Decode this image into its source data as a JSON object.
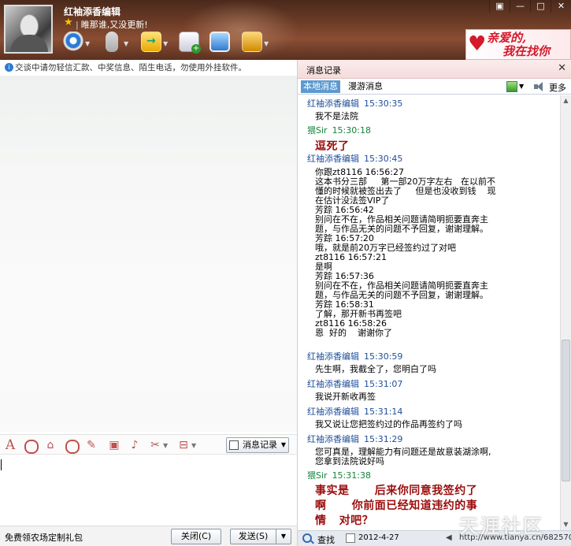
{
  "header": {
    "nickname": "红袖添香编辑",
    "signature": "睢那谁,又没更新!",
    "ad": {
      "line1": "亲爱的,",
      "line2": "我在找你"
    }
  },
  "left": {
    "notice": "交谈中请勿轻信汇款、中奖信息、陌生电话，勿使用外挂软件。",
    "history_button": "消息记录",
    "promo": "免费领农场定制礼包",
    "close_button": "关闭(C)",
    "send_button": "发送(S)"
  },
  "right": {
    "title": "消息记录",
    "tab_local": "本地消息",
    "tab_roam": "漫游消息",
    "more": "更多",
    "messages": [
      {
        "sender": "红袖添香编辑",
        "time": "15:30:35",
        "text": "我不是法院"
      },
      {
        "sender": "猥Sir",
        "time": "15:30:18",
        "text": "逗死了"
      },
      {
        "sender": "红袖添香编辑",
        "time": "15:30:45",
        "text": "你跟zt8116 16:56:27\n这本书分三部     第一部20万字左右   在以前不\n懂的时候就被签出去了     但是也没收到钱    现\n在估计没法签VIP了\n芳踪 16:56:42\n别问在不在，作品相关问题请简明扼要直奔主\n题，与作品无关的问题不予回复，谢谢理解。\n芳踪 16:57:20\n哦，就是前20万字已经签约过了对吧\nzt8116 16:57:21\n是啊\n芳踪 16:57:36\n别问在不在，作品相关问题请简明扼要直奔主\n题，与作品无关的问题不予回复，谢谢理解。\n芳踪 16:58:31\n了解，那开新书再签吧\nzt8116 16:58:26\n恩  好的    谢谢你了"
      },
      {
        "sender": "红袖添香编辑",
        "time": "15:30:59",
        "text": "先生啊，我截全了，您明白了吗"
      },
      {
        "sender": "红袖添香编辑",
        "time": "15:31:07",
        "text": "我说开新收再签"
      },
      {
        "sender": "红袖添香编辑",
        "time": "15:31:14",
        "text": "我又说让您把签约过的作品再签约了吗"
      },
      {
        "sender": "红袖添香编辑",
        "time": "15:31:29",
        "text": "您可真是，理解能力有问题还是故意装湖涂啊,\n您拿到法院说好吗"
      },
      {
        "sender": "猥Sir",
        "time": "15:31:38",
        "text": "事实是      后来你同意我签约了\n啊      你前面已经知道违约的事\n情   对吧？"
      }
    ],
    "search_label": "查找",
    "date": "2012-4-27",
    "watermark": "天涯社区",
    "url": "http://www.tianya.cn/6825708"
  }
}
